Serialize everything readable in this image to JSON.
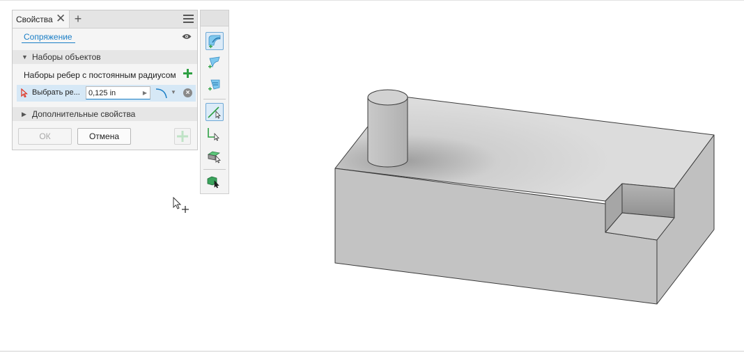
{
  "panel": {
    "tab_title": "Свойства",
    "tab_close": "✕",
    "tab_add": "+",
    "feature_name": "Сопряжение",
    "section_sets": "Наборы объектов",
    "edge_set_label": "Наборы ребер с постоянным радиусом",
    "select_label": "Выбрать ре...",
    "radius_value": "0,125 in",
    "section_advanced": "Дополнительные свойства",
    "ok_label": "ОК",
    "cancel_label": "Отмена"
  },
  "toolbar": {
    "icons": [
      "fillet-constant-icon",
      "fillet-variable-icon",
      "fillet-setback-icon",
      "select-edge-icon",
      "select-loop-icon",
      "select-feature-icon",
      "select-body-icon"
    ]
  },
  "colors": {
    "accent": "#1a7ec6",
    "add_green": "#2ea043",
    "selection_row": "#d6e8f6",
    "part_gray": "#c4c4c4"
  }
}
